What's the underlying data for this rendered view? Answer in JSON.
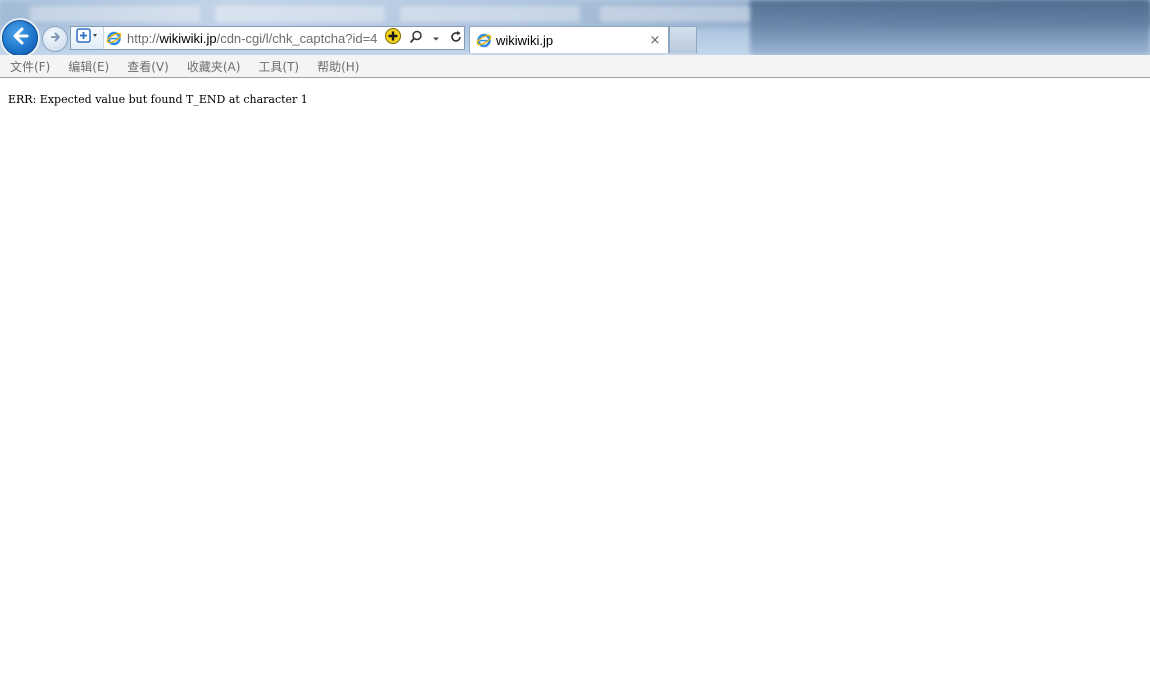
{
  "browser": {
    "address_bar": {
      "url_scheme": "http://",
      "url_host": "wikiwiki.jp",
      "url_path": "/cdn-cgi/l/chk_captcha?id=4"
    },
    "tab": {
      "title": "wikiwiki.jp",
      "close_glyph": "×"
    },
    "icons": {
      "back": "back-arrow-icon",
      "forward": "forward-arrow-icon",
      "shield": "shield-plus-icon",
      "ie": "internet-explorer-icon",
      "compat": "add-plus-icon",
      "search": "search-icon",
      "dropdown": "chevron-down-icon",
      "refresh": "refresh-icon"
    },
    "colors": {
      "accent": "#1c72c9",
      "menu_text": "#6e6e6e"
    }
  },
  "menu": {
    "items": [
      {
        "label": "文件(F)"
      },
      {
        "label": "编辑(E)"
      },
      {
        "label": "查看(V)"
      },
      {
        "label": "收藏夹(A)"
      },
      {
        "label": "工具(T)"
      },
      {
        "label": "帮助(H)"
      }
    ]
  },
  "page": {
    "body_text": "ERR: Expected value but found T_END at character 1"
  }
}
